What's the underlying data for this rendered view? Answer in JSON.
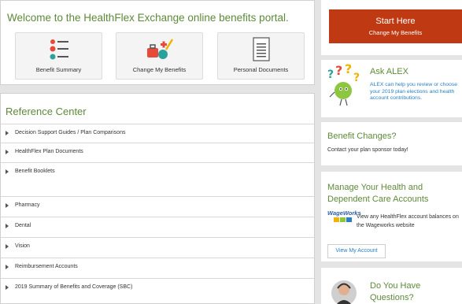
{
  "welcome": {
    "title": "Welcome to the HealthFlex Exchange online benefits portal.",
    "tiles": [
      {
        "label": "Benefit Summary",
        "icon": "benefit-summary-icon"
      },
      {
        "label": "Change My Benefits",
        "icon": "change-benefits-icon"
      },
      {
        "label": "Personal Documents",
        "icon": "document-icon"
      }
    ]
  },
  "reference_center": {
    "title": "Reference Center",
    "items": [
      "Decision Support Guides / Plan Comparisons",
      "HealthFlex Plan Documents",
      "Benefit Booklets",
      "Pharmacy",
      "Dental",
      "Vision",
      "Reimbursement Accounts",
      "2019 Summary of Benefits and Coverage (SBC)"
    ]
  },
  "start_here": {
    "title": "Start Here",
    "subtitle": "Change My Benefits"
  },
  "ask_alex": {
    "title": "Ask ALEX",
    "description": "ALEX can help you review or choose your 2019 plan elections and health account contributions."
  },
  "benefit_changes": {
    "title": "Benefit Changes?",
    "description": "Contact your plan sponsor today!"
  },
  "manage_accounts": {
    "title": "Manage Your Health and Dependent Care Accounts",
    "brand": "WageWorks",
    "description": "View any HealthFlex account balances on the Wageworks website",
    "button": "View My Account"
  },
  "questions": {
    "title": "Do You Have Questions?"
  },
  "colors": {
    "accent_green": "#5d8a3a",
    "start_button": "#bf3a12",
    "link_blue": "#2a7fc2"
  }
}
